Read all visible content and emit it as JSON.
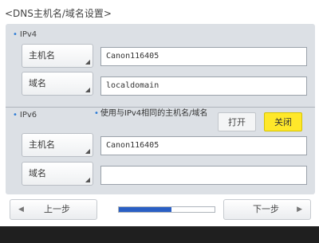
{
  "title": "<DNS主机名/域名设置>",
  "ipv4": {
    "label": "IPv4",
    "host_label": "主机名",
    "host_value": "Canon116405",
    "domain_label": "域名",
    "domain_value": "localdomain"
  },
  "ipv6": {
    "label": "IPv6",
    "description": "使用与IPv4相同的主机名/域名",
    "toggle_on_label": "打开",
    "toggle_off_label": "关闭",
    "toggle_selected": "关闭",
    "host_label": "主机名",
    "host_value": "Canon116405",
    "domain_label": "域名",
    "domain_value": ""
  },
  "nav": {
    "prev_label": "上一步",
    "next_label": "下一步",
    "progress": 0.55
  },
  "icons": {
    "prev": "left-arrow-icon",
    "next": "right-arrow-icon",
    "corner": "corner-marker-icon"
  },
  "colors": {
    "accent": "#2a5fc4",
    "selected": "#ffe82a",
    "panel": "#dce0e5"
  }
}
